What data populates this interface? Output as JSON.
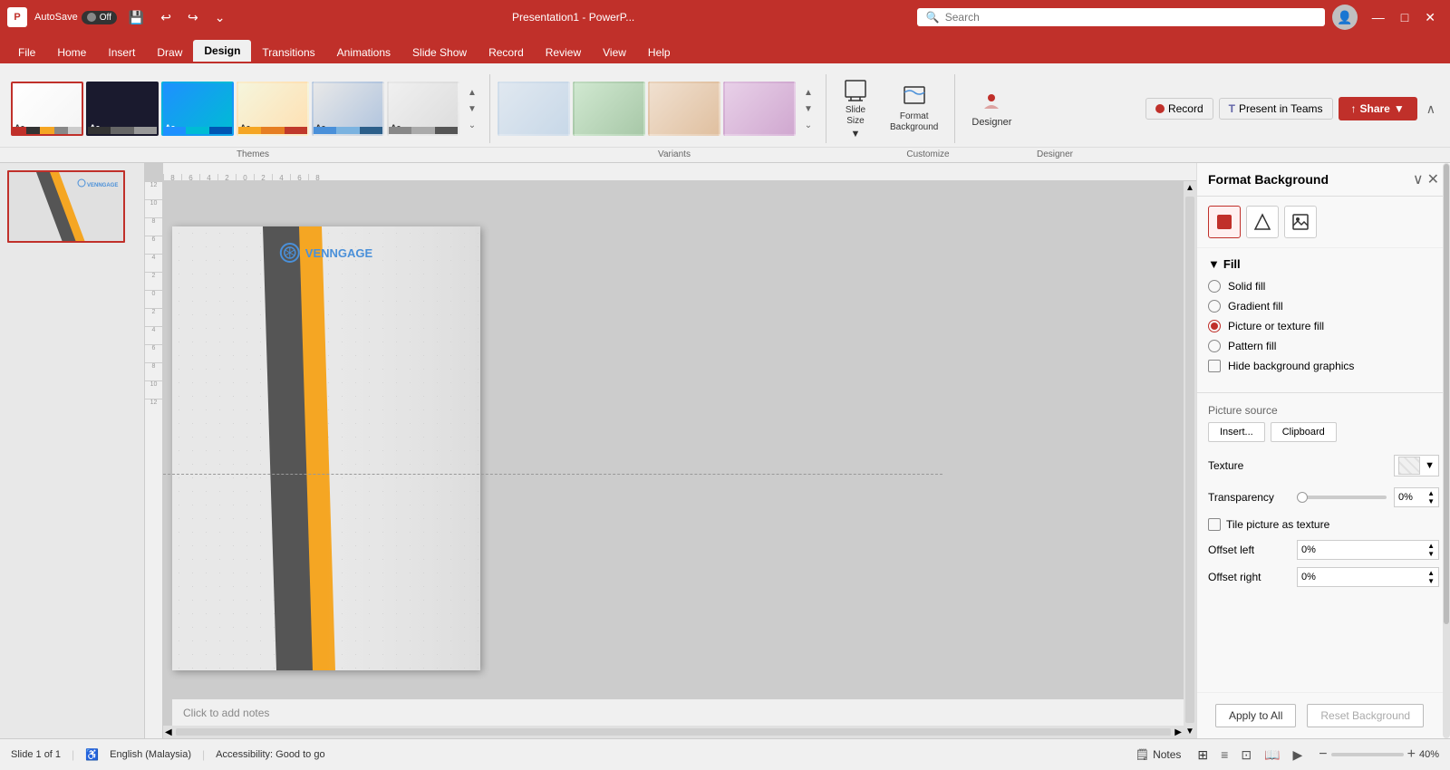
{
  "titlebar": {
    "logo": "P",
    "autosave_label": "AutoSave",
    "toggle_label": "Off",
    "title": "Presentation1 - PowerP...",
    "search_placeholder": "Search",
    "minimize": "—",
    "restore": "□",
    "close": "✕"
  },
  "ribbontabs": {
    "tabs": [
      "File",
      "Home",
      "Insert",
      "Draw",
      "Design",
      "Transitions",
      "Animations",
      "Slide Show",
      "Record",
      "Review",
      "View",
      "Help"
    ],
    "active": "Design"
  },
  "ribbon": {
    "themes_label": "Themes",
    "variants_label": "Variants",
    "customize_label": "Customize",
    "designer_label": "Designer",
    "slide_size_label": "Slide\nSize",
    "format_bg_label": "Format\nBackground",
    "record_label": "Record",
    "present_label": "Present in Teams",
    "share_label": "Share"
  },
  "themes": [
    {
      "id": 1,
      "selected": true
    },
    {
      "id": 2
    },
    {
      "id": 3
    },
    {
      "id": 4
    },
    {
      "id": 5
    },
    {
      "id": 6
    }
  ],
  "variants": [
    {
      "id": 1
    },
    {
      "id": 2
    },
    {
      "id": 3
    },
    {
      "id": 4
    }
  ],
  "slide": {
    "number": "1",
    "venngage_text": "VENNGAGE",
    "slide_count": "Slide 1 of 1"
  },
  "format_bg_panel": {
    "title": "Format Background",
    "fill_label": "Fill",
    "solid_fill": "Solid fill",
    "gradient_fill": "Gradient fill",
    "picture_texture_fill": "Picture or texture fill",
    "pattern_fill": "Pattern fill",
    "hide_bg_graphics": "Hide background graphics",
    "picture_source_label": "Picture source",
    "insert_btn": "Insert...",
    "clipboard_btn": "Clipboard",
    "texture_label": "Texture",
    "transparency_label": "Transparency",
    "transparency_value": "0%",
    "tile_picture": "Tile picture as texture",
    "offset_left_label": "Offset left",
    "offset_left_value": "0%",
    "offset_right_label": "Offset right",
    "offset_right_value": "0%",
    "apply_to_all": "Apply to All",
    "reset_background": "Reset Background"
  },
  "statusbar": {
    "slide_count": "Slide 1 of 1",
    "language": "English (Malaysia)",
    "accessibility": "Accessibility: Good to go",
    "notes_label": "Notes",
    "zoom_level": "40%"
  },
  "icons": {
    "undo": "↩",
    "redo": "↪",
    "save": "💾",
    "quick_access": "⌄",
    "paint": "🎨",
    "pentagon": "⬠",
    "image": "🖼",
    "chevron_down": "▼",
    "chevron_up": "▲",
    "chevron_right": "▶",
    "record_dot": "⏺",
    "teams_icon": "T",
    "share_icon": "↑",
    "normal_view": "⊞",
    "outline_view": "≡",
    "slide_sorter": "⊡",
    "reading_view": "📖",
    "presentation": "▶",
    "minus": "−",
    "plus": "+",
    "collapse": "∨",
    "expand": "⌄",
    "notes": "🗒",
    "accessibility": "♿",
    "search": "🔍"
  }
}
